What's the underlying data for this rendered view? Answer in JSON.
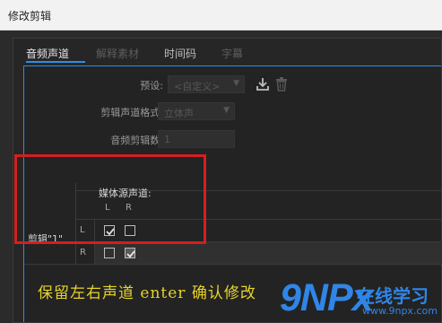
{
  "window": {
    "title": "修改剪辑"
  },
  "tabs": [
    {
      "label": "音频声道",
      "state": "active"
    },
    {
      "label": "解释素材",
      "state": "disabled"
    },
    {
      "label": "时间码",
      "state": "normal"
    },
    {
      "label": "字幕",
      "state": "disabled"
    }
  ],
  "form": {
    "preset_label": "预设:",
    "preset_value": "<自定义>",
    "channel_format_label": "剪辑声道格式:",
    "channel_format_value": "立体声",
    "audio_clip_count_label": "音频剪辑数:",
    "audio_clip_count_value": "1"
  },
  "icons": {
    "download": "download-icon",
    "trash": "trash-icon"
  },
  "grid": {
    "header": "媒体源声道:",
    "col_L": "L",
    "col_R": "R",
    "clip_label": "剪辑\"1\"",
    "rows": [
      {
        "channel": "L",
        "L_checked": true,
        "R_checked": false
      },
      {
        "channel": "R",
        "L_checked": false,
        "R_checked": true
      }
    ]
  },
  "caption": "保留左右声道  enter 确认修改",
  "watermark": {
    "brand": "9NPx",
    "text": "在线学习",
    "url": "www.9npx.com"
  },
  "colors": {
    "accent": "#2d8ceb",
    "highlight": "#d31f1f",
    "caption": "#e6d32a",
    "watermark": "#2f86e8"
  }
}
